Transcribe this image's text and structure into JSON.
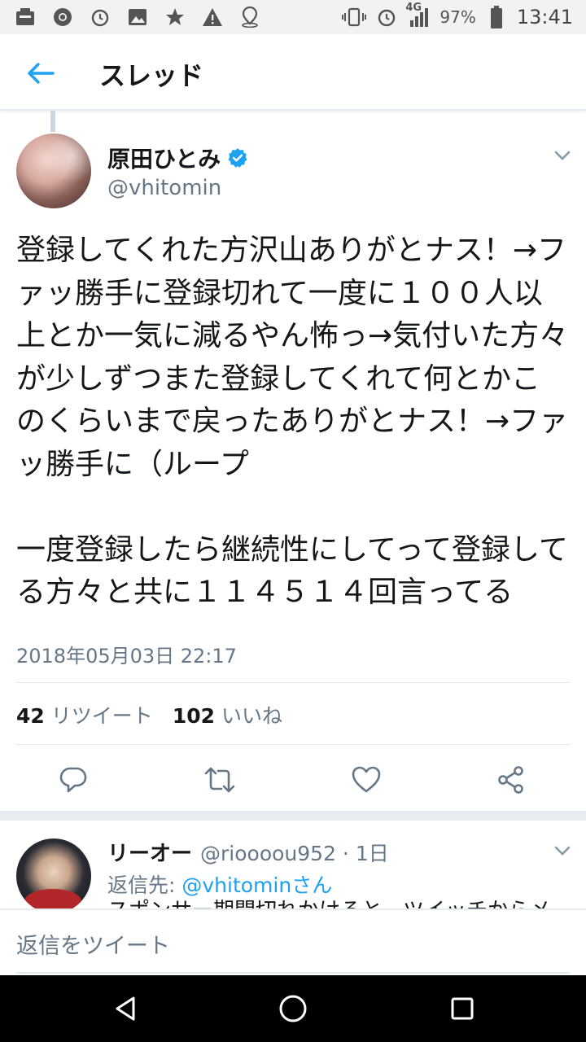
{
  "status_bar": {
    "battery_percent": "97%",
    "time": "13:41",
    "network": "4G",
    "icons_left": [
      "notification-icon",
      "chrome-icon",
      "alarm-icon",
      "image-icon",
      "star-icon",
      "warning-icon",
      "location-icon"
    ],
    "icons_right": [
      "vibrate-icon",
      "alarm-icon",
      "signal-icon",
      "battery-icon"
    ]
  },
  "app_bar": {
    "title": "スレッド"
  },
  "tweet": {
    "display_name": "原田ひとみ",
    "handle": "@vhitomin",
    "text": "登録してくれた方沢山ありがとナス！→ファッ勝手に登録切れて一度に１００人以上とか一気に減るやん怖っ→気付いた方々が少しずつまた登録してくれて何とかこのくらいまで戻ったありがとナス！→ファッ勝手に（ループ\n\n一度登録したら継続性にしてって登録してる方々と共に１１４５１４回言ってる",
    "timestamp": "2018年05月03日 22:17",
    "retweet_count": "42",
    "retweet_label": "リツイート",
    "like_count": "102",
    "like_label": "いいね"
  },
  "reply": {
    "display_name": "リーオー",
    "handle_time": "@rioooou952 · 1日",
    "reply_to_prefix": "返信先: ",
    "reply_to_mention": "@vhitominさん",
    "snippet": "スポンサー期間切れかけると、ツイッチからメ"
  },
  "compose": {
    "placeholder": "返信をツイート"
  },
  "colors": {
    "accent": "#1da1f2",
    "secondary_text": "#657786",
    "primary_text": "#14171a"
  }
}
